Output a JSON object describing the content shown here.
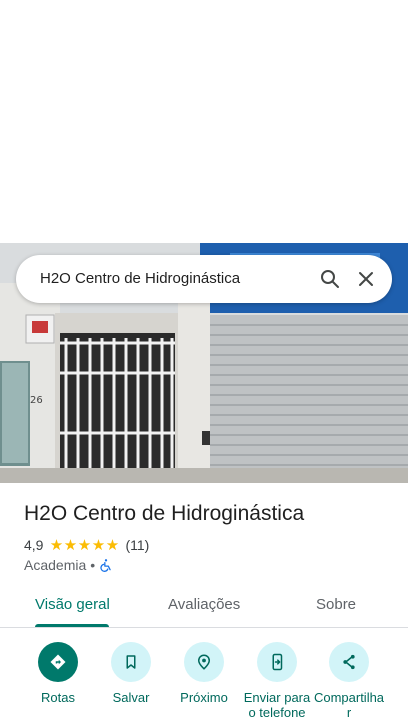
{
  "search": {
    "query": "H2O Centro de Hidroginástica"
  },
  "place": {
    "name": "H2O Centro de Hidroginástica",
    "rating": "4,9",
    "stars": 5,
    "review_count": "(11)",
    "category": "Academia",
    "separator": "•",
    "accessibility_icon": "wheelchair-icon"
  },
  "tabs": [
    {
      "label": "Visão geral",
      "active": true
    },
    {
      "label": "Avaliações",
      "active": false
    },
    {
      "label": "Sobre",
      "active": false
    }
  ],
  "actions": [
    {
      "label": "Rotas",
      "icon": "directions-icon"
    },
    {
      "label": "Salvar",
      "icon": "bookmark-icon"
    },
    {
      "label": "Próximo",
      "icon": "nearby-icon"
    },
    {
      "label": "Enviar para o telefone",
      "icon": "send-to-phone-icon"
    },
    {
      "label": "Compartilhar",
      "icon": "share-icon"
    }
  ],
  "colors": {
    "accent": "#00796b",
    "action_bg": "#d2f4f8",
    "star": "#fbbc04"
  }
}
